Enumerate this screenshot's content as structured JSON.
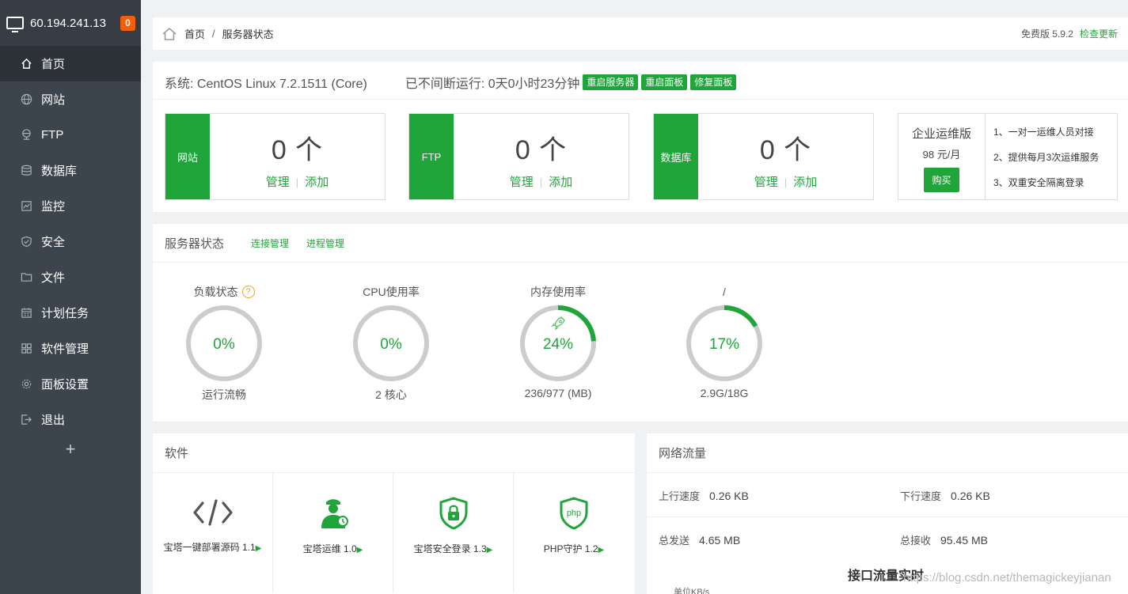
{
  "sidebar": {
    "ip": "60.194.241.13",
    "badge": "0",
    "items": [
      {
        "label": "首页",
        "icon": "home-icon"
      },
      {
        "label": "网站",
        "icon": "globe-icon"
      },
      {
        "label": "FTP",
        "icon": "ftp-icon"
      },
      {
        "label": "数据库",
        "icon": "database-icon"
      },
      {
        "label": "监控",
        "icon": "monitor-icon"
      },
      {
        "label": "安全",
        "icon": "shield-icon"
      },
      {
        "label": "文件",
        "icon": "folder-icon"
      },
      {
        "label": "计划任务",
        "icon": "calendar-icon"
      },
      {
        "label": "软件管理",
        "icon": "grid-icon"
      },
      {
        "label": "面板设置",
        "icon": "gear-icon"
      },
      {
        "label": "退出",
        "icon": "logout-icon"
      }
    ],
    "add": "+"
  },
  "breadcrumb": {
    "home": "首页",
    "sep": "/",
    "current": "服务器状态",
    "version": "免费版 5.9.2",
    "update": "检查更新"
  },
  "system": {
    "os": "系统: CentOS Linux 7.2.1511 (Core)",
    "uptime": "已不间断运行: 0天0小时23分钟",
    "btn_restart_server": "重启服务器",
    "btn_restart_panel": "重启面板",
    "btn_repair_panel": "修复面板"
  },
  "stats": [
    {
      "label": "网站",
      "count": "0 个",
      "manage": "管理",
      "sep": "|",
      "add": "添加"
    },
    {
      "label": "FTP",
      "count": "0 个",
      "manage": "管理",
      "sep": "|",
      "add": "添加"
    },
    {
      "label": "数据库",
      "count": "0 个",
      "manage": "管理",
      "sep": "|",
      "add": "添加"
    }
  ],
  "enterprise": {
    "title": "企业运维版",
    "price": "98 元/月",
    "buy": "购买",
    "features": [
      "1、一对一运维人员对接",
      "2、提供每月3次运维服务",
      "3、双重安全隔离登录"
    ]
  },
  "status": {
    "title": "服务器状态",
    "link_conn": "连接管理",
    "link_proc": "进程管理",
    "help": "?",
    "gauges": [
      {
        "title": "负载状态",
        "value": "0%",
        "percent": 0,
        "sub": "运行流畅"
      },
      {
        "title": "CPU使用率",
        "value": "0%",
        "percent": 0,
        "sub": "2 核心"
      },
      {
        "title": "内存使用率",
        "value": "24%",
        "percent": 24,
        "sub": "236/977 (MB)",
        "icon": "rocket-icon"
      },
      {
        "title": "/",
        "value": "17%",
        "percent": 17,
        "sub": "2.9G/18G"
      }
    ],
    "color_track": "#cccccc",
    "color_fill": "#20a53a"
  },
  "software": {
    "title": "软件",
    "items": [
      {
        "name": "宝塔一键部署源码 1.1",
        "icon": "code-icon"
      },
      {
        "name": "宝塔运维 1.0",
        "icon": "operator-icon"
      },
      {
        "name": "宝塔安全登录 1.3",
        "icon": "lock-shield-icon"
      },
      {
        "name": "PHP守护 1.2",
        "icon": "php-shield-icon"
      }
    ],
    "arrow": "▶"
  },
  "network": {
    "title": "网络流量",
    "up_label": "上行速度",
    "up_value": "0.26 KB",
    "down_label": "下行速度",
    "down_value": "0.26 KB",
    "sent_label": "总发送",
    "sent_value": "4.65 MB",
    "recv_label": "总接收",
    "recv_value": "95.45 MB",
    "chart_title": "接口流量实时",
    "unit": "单位KB/s"
  },
  "watermark": "https://blog.csdn.net/themagickeyjianan",
  "colors": {
    "accent": "#20a53a",
    "sidebar": "#3c444d",
    "badge": "#f25e0b"
  }
}
